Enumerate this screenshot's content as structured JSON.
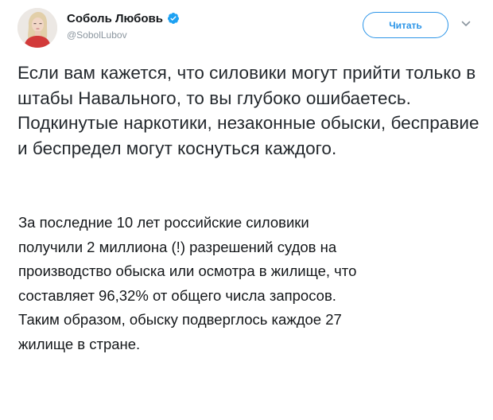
{
  "author": {
    "display_name": "Соболь Любовь",
    "handle": "@SobolLubov",
    "verified": true,
    "avatar_icon": "profile-photo"
  },
  "follow_button": {
    "label": "Читать"
  },
  "more_icon": "chevron-down-icon",
  "tweet": {
    "paragraph_1": "Если вам кажется, что силовики могут прийти только в штабы Навального, то вы глубоко ошибаетесь. Подкинутые наркотики, незаконные обыски, бесправие и беспредел могут коснуться каждого.",
    "paragraph_2": "За последние 10 лет российские силовики получили 2 миллиона (!) разрешений судов на производство обыска или осмотра в жилище, что составляет 96,32% от общего числа запросов. Таким образом, обыску подверглось каждое 27 жилище в стране."
  },
  "colors": {
    "accent": "#2c95e8",
    "verified": "#1da1f2",
    "text": "#14171a",
    "secondary_text": "#8a959e"
  }
}
